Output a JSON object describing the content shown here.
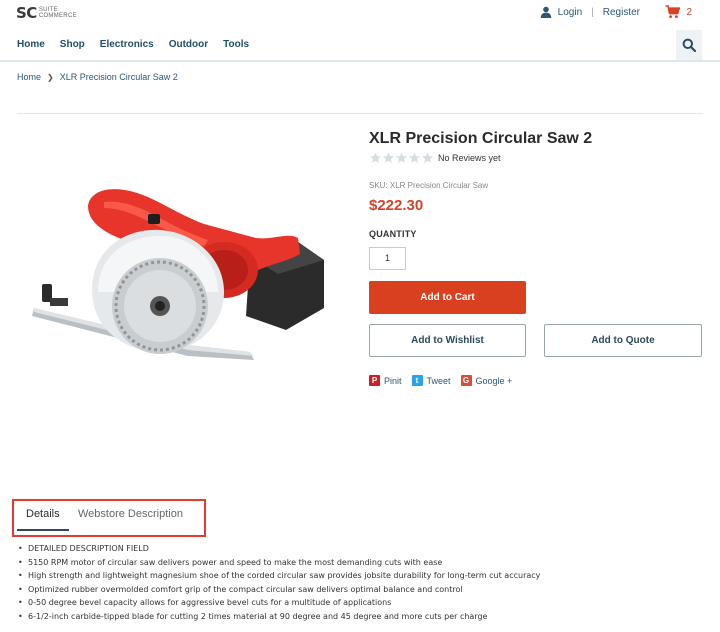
{
  "header": {
    "logo_main": "SC",
    "logo_sub_line1": "SUITE",
    "logo_sub_line2": "COMMERCE",
    "login_label": "Login",
    "register_label": "Register",
    "cart_count": "2"
  },
  "nav": {
    "items": [
      {
        "label": "Home"
      },
      {
        "label": "Shop"
      },
      {
        "label": "Electronics"
      },
      {
        "label": "Outdoor"
      },
      {
        "label": "Tools"
      }
    ]
  },
  "breadcrumb": {
    "home": "Home",
    "current": "XLR Precision Circular Saw 2"
  },
  "product": {
    "title": "XLR Precision Circular Saw 2",
    "reviews": "No Reviews yet",
    "rating_stars": 0,
    "sku": "SKU: XLR Precision Circular Saw",
    "price": "$222.30",
    "quantity_label": "QUANTITY",
    "quantity_value": "1",
    "add_to_cart": "Add to Cart",
    "add_to_wishlist": "Add to Wishlist",
    "add_to_quote": "Add to Quote"
  },
  "share": {
    "pinit": "Pinit",
    "tweet": "Tweet",
    "google": "Google +"
  },
  "tabs": {
    "details": "Details",
    "webstore": "Webstore Description"
  },
  "description": [
    "DETAILED DESCRIPTION FIELD",
    "5150 RPM motor of circular saw delivers power and speed to make the most demanding cuts with ease",
    "High strength and lightweight magnesium shoe of the corded circular saw provides jobsite durability for long-term cut accuracy",
    "Optimized rubber overmolded comfort grip of the compact circular saw delivers optimal balance and control",
    "0-50 degree bevel capacity allows for aggressive bevel cuts for a multitude of applications",
    "6-1/2-inch carbide-tipped blade for cutting 2 times material at 90 degree and 45 degree and more cuts per charge"
  ],
  "colors": {
    "accent": "#d8401f",
    "nav_text": "#234f66",
    "highlight_box": "#e53a2f"
  },
  "icons": {
    "user": "user-icon",
    "cart": "cart-icon",
    "search": "search-icon",
    "star": "star-icon",
    "pinterest": "pinterest-icon",
    "twitter": "twitter-icon",
    "google": "google-plus-icon"
  }
}
